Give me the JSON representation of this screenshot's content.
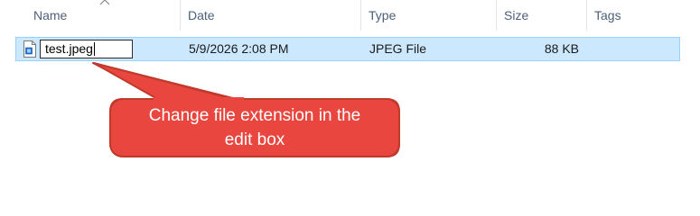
{
  "columns": {
    "name": "Name",
    "date": "Date",
    "type": "Type",
    "size": "Size",
    "tags": "Tags"
  },
  "file": {
    "rename_value": "test.jpeg",
    "date": "5/9/2026 2:08 PM",
    "type": "JPEG File",
    "size": "88 KB",
    "icon": "image-file-icon"
  },
  "callout": {
    "line1": "Change file extension in the",
    "line2": "edit box",
    "fill_color": "#e8463f",
    "border_color": "#c0392b"
  },
  "colors": {
    "selection_bg": "#cce8ff",
    "selection_border": "#99d1ff",
    "header_text": "#4c607a"
  }
}
